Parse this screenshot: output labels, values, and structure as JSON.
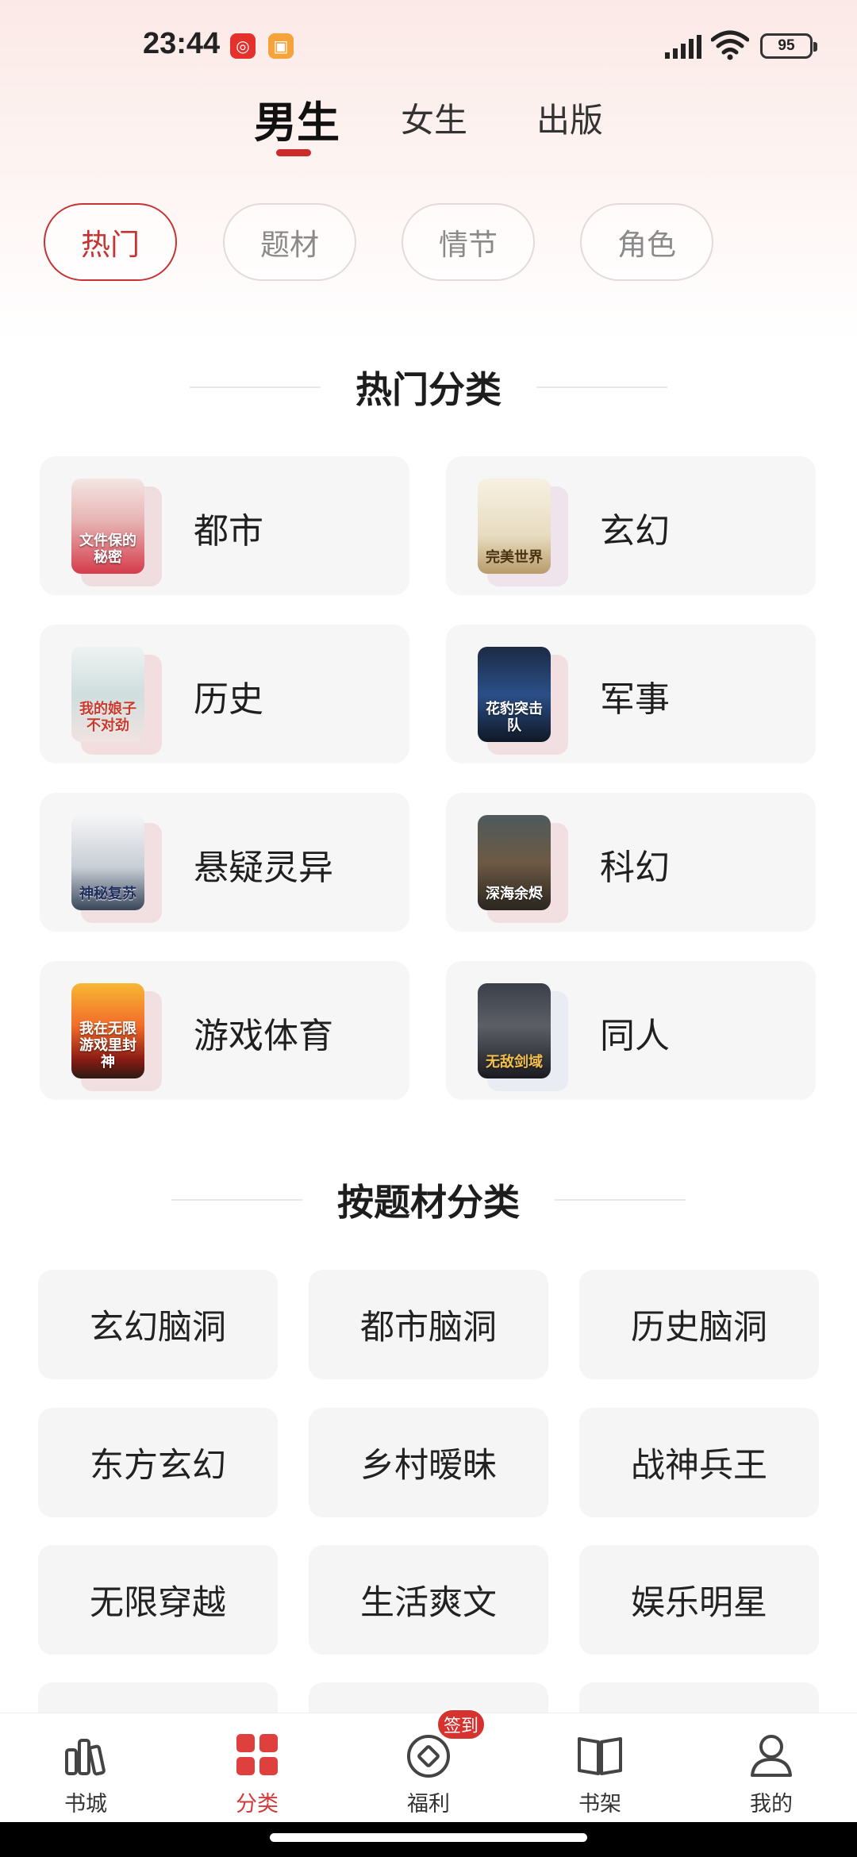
{
  "status_bar": {
    "time": "23:44",
    "battery": "95"
  },
  "gender_tabs": [
    {
      "label": "男生",
      "active": true
    },
    {
      "label": "女生",
      "active": false
    },
    {
      "label": "出版",
      "active": false
    }
  ],
  "filters": [
    {
      "label": "热门",
      "active": true
    },
    {
      "label": "题材",
      "active": false
    },
    {
      "label": "情节",
      "active": false
    },
    {
      "label": "角色",
      "active": false
    }
  ],
  "hot_section": {
    "title": "热门分类",
    "items": [
      {
        "label": "都市",
        "cover_text": "文件保的秘密"
      },
      {
        "label": "玄幻",
        "cover_text": "完美世界"
      },
      {
        "label": "历史",
        "cover_text": "我的娘子不对劲"
      },
      {
        "label": "军事",
        "cover_text": "花豹突击队"
      },
      {
        "label": "悬疑灵异",
        "cover_text": "神秘复苏"
      },
      {
        "label": "科幻",
        "cover_text": "深海余烬"
      },
      {
        "label": "游戏体育",
        "cover_text": "我在无限游戏里封神"
      },
      {
        "label": "同人",
        "cover_text": "无敌剑域"
      }
    ]
  },
  "genre_section": {
    "title": "按题材分类",
    "items": [
      "玄幻脑洞",
      "都市脑洞",
      "历史脑洞",
      "东方玄幻",
      "乡村暧昧",
      "战神兵王",
      "无限穿越",
      "生活爽文",
      "娱乐明星",
      "",
      "",
      ""
    ]
  },
  "bottom_nav": [
    {
      "label": "书城",
      "icon": "bookstore-icon",
      "active": false
    },
    {
      "label": "分类",
      "icon": "category-icon",
      "active": true
    },
    {
      "label": "福利",
      "icon": "welfare-icon",
      "active": false,
      "badge": "签到"
    },
    {
      "label": "书架",
      "icon": "bookshelf-icon",
      "active": false
    },
    {
      "label": "我的",
      "icon": "profile-icon",
      "active": false
    }
  ],
  "colors": {
    "accent": "#d33a3a",
    "card_bg": "#f6f6f7"
  }
}
